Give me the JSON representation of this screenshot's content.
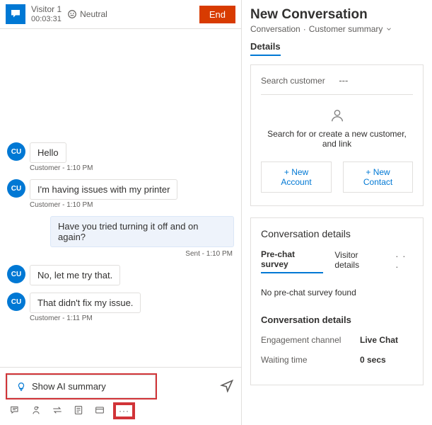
{
  "header": {
    "visitor_name": "Visitor 1",
    "timer": "00:03:31",
    "sentiment": "Neutral",
    "end_label": "End"
  },
  "messages": {
    "cu_initials": "CU",
    "m1_text": "Hello",
    "m1_meta": "Customer - 1:10 PM",
    "m2_text": "I'm having issues with my printer",
    "m2_meta": "Customer - 1:10 PM",
    "agent_text": "Have you tried turning it off and on again?",
    "agent_meta": "Sent - 1:10 PM",
    "m3_text": "No, let me try that.",
    "m4_text": "That didn't fix my issue.",
    "m4_meta": "Customer - 1:11 PM"
  },
  "composer": {
    "ai_label": "Show AI summary",
    "more_label": "···"
  },
  "right": {
    "title": "New Conversation",
    "sub_left": "Conversation",
    "sub_right": "Customer summary",
    "details_tab": "Details",
    "search_label": "Search customer",
    "search_value": "---",
    "search_hint": "Search for or create a new customer, and link",
    "new_account": "+ New Account",
    "new_contact": "+ New Contact",
    "conv_details_title": "Conversation details",
    "tab_prechat": "Pre-chat survey",
    "tab_visitor": "Visitor details",
    "no_prechat": "No pre-chat survey found",
    "sub_conv_details": "Conversation details",
    "kv1_k": "Engagement channel",
    "kv1_v": "Live Chat",
    "kv2_k": "Waiting time",
    "kv2_v": "0 secs"
  }
}
